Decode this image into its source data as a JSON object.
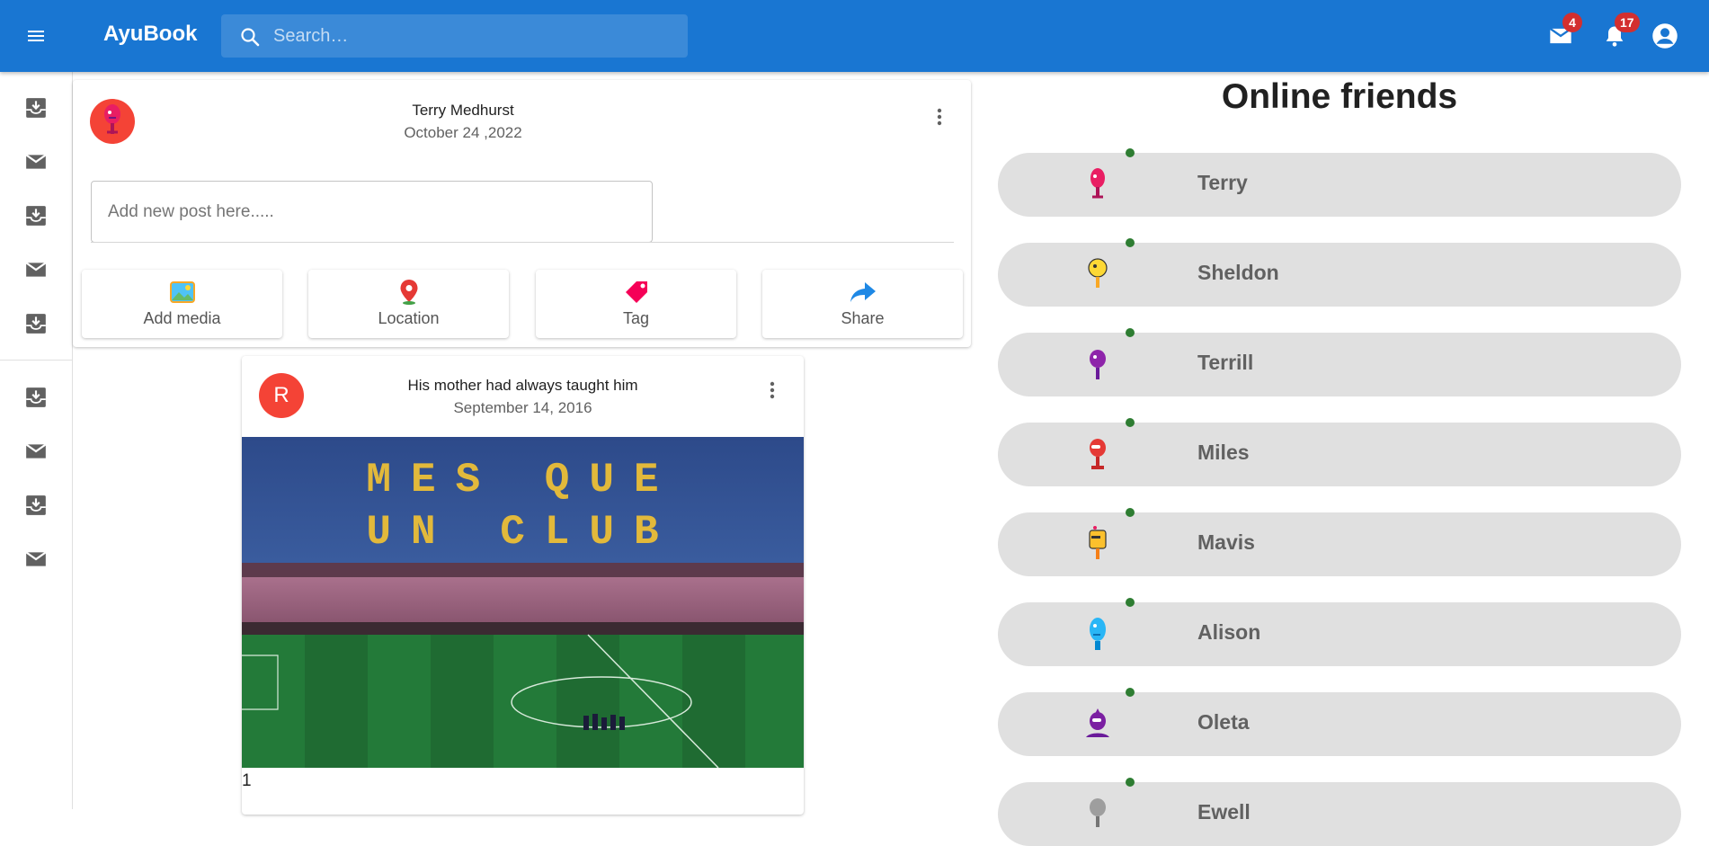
{
  "app": {
    "brand": "AyuBook",
    "accent_color": "#1976d2"
  },
  "search": {
    "placeholder": "Search…",
    "value": ""
  },
  "header": {
    "mail_badge": "4",
    "notifications_badge": "17",
    "icons": [
      "menu-icon",
      "search-icon",
      "mail-icon",
      "bell-icon",
      "account-circle-icon"
    ]
  },
  "sidebar": {
    "items": [
      {
        "icon": "inbox-icon"
      },
      {
        "icon": "mail-icon"
      },
      {
        "icon": "inbox-icon"
      },
      {
        "icon": "mail-icon"
      },
      {
        "icon": "inbox-icon"
      },
      {
        "icon": "inbox-icon"
      },
      {
        "icon": "mail-icon"
      },
      {
        "icon": "inbox-icon"
      },
      {
        "icon": "mail-icon"
      }
    ]
  },
  "composer": {
    "user_name": "Terry Medhurst",
    "date": "October 24 ,2022",
    "input_placeholder": "Add new post here.....",
    "input_value": "",
    "actions": [
      {
        "label": "Add media",
        "icon": "image-icon"
      },
      {
        "label": "Location",
        "icon": "map-pin-icon"
      },
      {
        "label": "Tag",
        "icon": "tag-icon"
      },
      {
        "label": "Share",
        "icon": "share-arrow-icon"
      }
    ]
  },
  "post": {
    "avatar_letter": "R",
    "title": "His mother had always taught him",
    "date": "September 14, 2016",
    "image_alt": "Stadium with stands spelling MES QUE UN CLUB",
    "count": "1"
  },
  "friends": {
    "title": "Online friends",
    "status_color": "#2e7d32",
    "list": [
      {
        "name": "Terry",
        "color": "#e91e63"
      },
      {
        "name": "Sheldon",
        "color": "#fdd835"
      },
      {
        "name": "Terrill",
        "color": "#8e24aa"
      },
      {
        "name": "Miles",
        "color": "#e53935"
      },
      {
        "name": "Mavis",
        "color": "#fbc02d"
      },
      {
        "name": "Alison",
        "color": "#29b6f6"
      },
      {
        "name": "Oleta",
        "color": "#7b1fa2"
      },
      {
        "name": "Ewell",
        "color": "#9e9e9e"
      }
    ]
  }
}
